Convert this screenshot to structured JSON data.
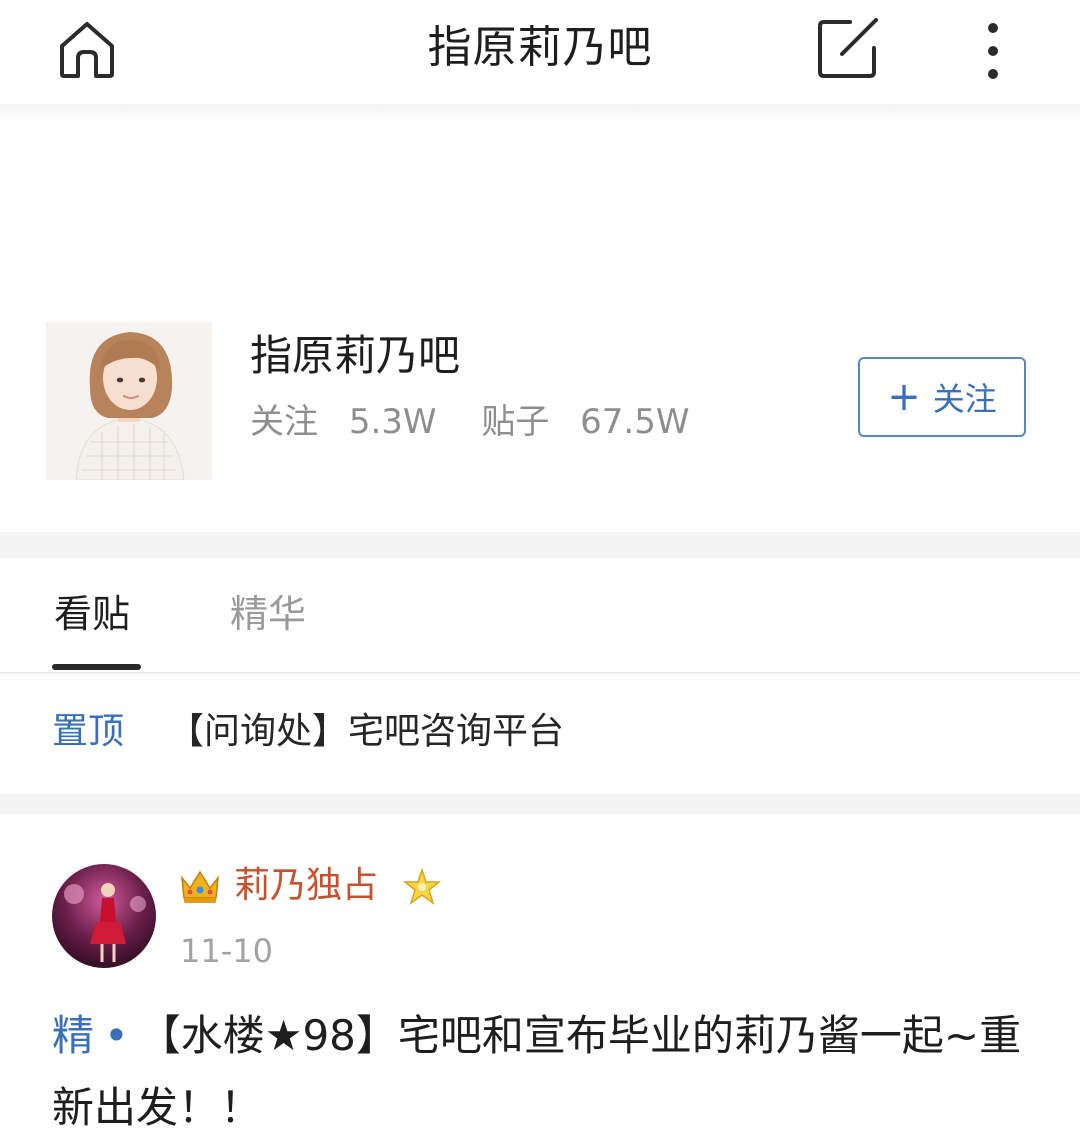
{
  "nav": {
    "title": "指原莉乃吧",
    "icons": {
      "home": "home-icon",
      "compose": "compose-icon",
      "more": "more-vertical-icon"
    }
  },
  "forum": {
    "name": "指原莉乃吧",
    "follow_label": "关注",
    "follow_count": "5.3W",
    "posts_label": "贴子",
    "posts_count": "67.5W",
    "follow_button": {
      "icon": "plus-icon",
      "label": "关注"
    }
  },
  "tabs": [
    {
      "label": "看贴",
      "active": true
    },
    {
      "label": "精华",
      "active": false
    }
  ],
  "pinned": {
    "label": "置顶",
    "title": "【问询处】宅吧咨询平台"
  },
  "post": {
    "username": "莉乃独占",
    "date": "11-10",
    "tag": "精",
    "separator": "•",
    "title": "【水楼★98】宅吧和宣布毕业的莉乃酱一起~重新出发！！",
    "badges": [
      "crown-icon",
      "star-badge-icon"
    ]
  },
  "colors": {
    "accent_blue": "#3a6fbb",
    "username_orange": "#c8512c",
    "muted_gray": "#8e8e8e",
    "band_gray": "#f4f4f4"
  }
}
